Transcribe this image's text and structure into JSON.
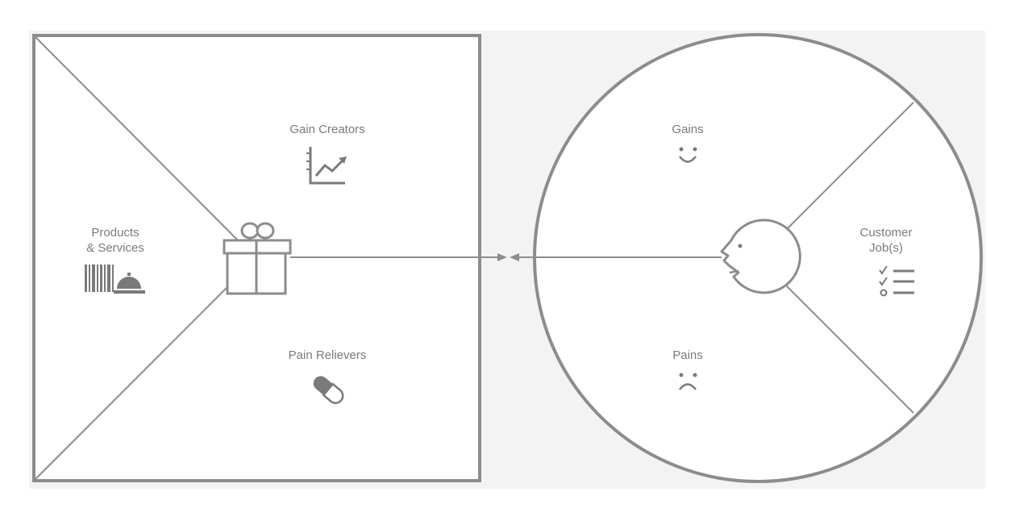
{
  "colors": {
    "panel_background": "#f3f3f3",
    "stroke": "#8c8c8c",
    "icon": "#7a7a7a",
    "text": "#7a7a7a"
  },
  "value_map": {
    "gain_creators": {
      "label": "Gain Creators",
      "icon": "rising-chart-icon"
    },
    "products_services": {
      "line1": "Products",
      "line2": "& Services",
      "icons": [
        "barcode-icon",
        "service-bell-icon"
      ]
    },
    "pain_relievers": {
      "label": "Pain Relievers",
      "icon": "pill-icon"
    },
    "center_icon": "gift-icon"
  },
  "customer_profile": {
    "gains": {
      "label": "Gains",
      "icon": "smile-icon"
    },
    "customer_jobs": {
      "line1": "Customer",
      "line2": "Job(s)",
      "icon": "checklist-icon"
    },
    "pains": {
      "label": "Pains",
      "icon": "frown-icon"
    },
    "center_icon": "customer-face-icon"
  },
  "connector": {
    "icon": "double-arrow-icon"
  }
}
